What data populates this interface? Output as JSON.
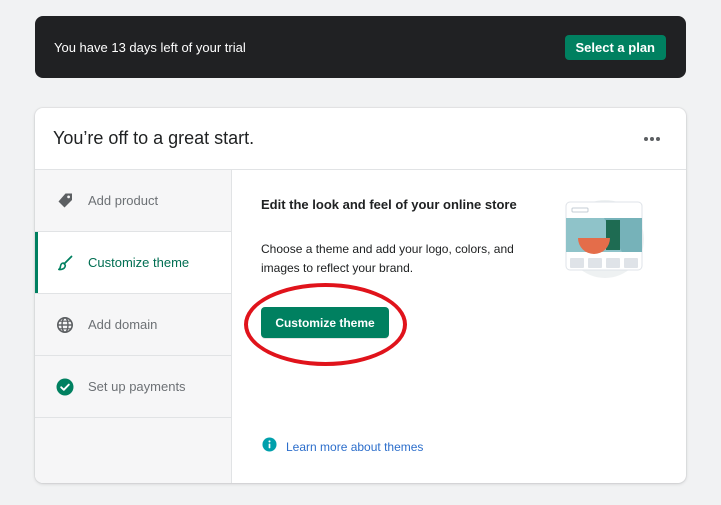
{
  "trial_banner": {
    "message": "You have 13 days left of your trial",
    "select_plan_label": "Select a plan"
  },
  "setup_card": {
    "title": "You’re off to a great start.",
    "steps": [
      {
        "label": "Add product",
        "icon": "tag-icon",
        "active": false,
        "completed": false
      },
      {
        "label": "Customize theme",
        "icon": "paintbrush-icon",
        "active": true,
        "completed": false
      },
      {
        "label": "Add domain",
        "icon": "globe-icon",
        "active": false,
        "completed": false
      },
      {
        "label": "Set up payments",
        "icon": "checkmark-circle-icon",
        "active": false,
        "completed": true
      }
    ],
    "detail": {
      "heading": "Edit the look and feel of your online store",
      "description": "Choose a theme and add your logo, colors, and images to reflect your brand.",
      "button_label": "Customize theme",
      "learn_more_label": "Learn more about themes"
    }
  },
  "colors": {
    "primary": "#008060",
    "banner_bg": "#202123",
    "annotation": "#e0131b",
    "link": "#2c6ecb",
    "info_icon": "#00a0ac"
  }
}
